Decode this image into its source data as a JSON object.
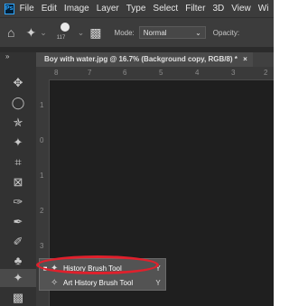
{
  "menubar": {
    "logo_label": "Ps",
    "items": [
      "File",
      "Edit",
      "Image",
      "Layer",
      "Type",
      "Select",
      "Filter",
      "3D",
      "View",
      "Wi"
    ]
  },
  "options_bar": {
    "brush_size": "117",
    "mode_label": "Mode:",
    "mode_value": "Normal",
    "opacity_label": "Opacity:"
  },
  "document_tab": {
    "title": "Boy with water.jpg @ 16.7% (Background copy, RGB/8) *",
    "close_glyph": "×"
  },
  "rulers": {
    "top_ticks": [
      "8",
      "7",
      "6",
      "5",
      "4",
      "3",
      "2"
    ],
    "left_ticks": [
      "1",
      "0",
      "1",
      "2",
      "3"
    ]
  },
  "flyout": {
    "items": [
      {
        "label": "History Brush Tool",
        "shortcut": "Y",
        "selected": true
      },
      {
        "label": "Art History Brush Tool",
        "shortcut": "Y",
        "selected": false
      }
    ]
  },
  "colors": {
    "highlight": "#e0202c",
    "background": "#2b2b2b"
  }
}
